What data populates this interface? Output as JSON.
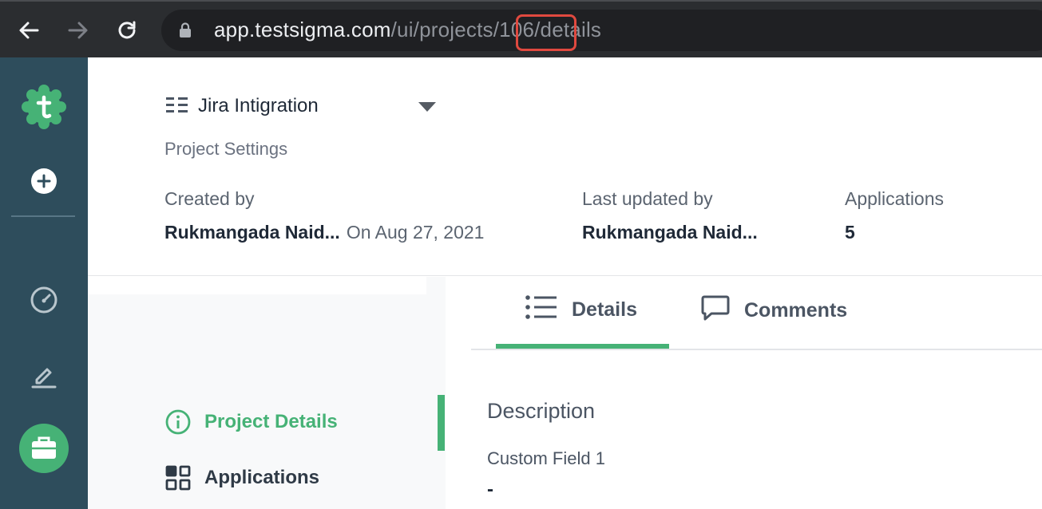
{
  "browser": {
    "url_host": "app.testsigma.com",
    "url_path": "/ui/projects/106/details"
  },
  "header": {
    "project_name": "Jira Intigration",
    "project_subtitle": "Project Settings",
    "created_by_label": "Created by",
    "created_by_value": "Rukmangada Naid...",
    "created_on": "On Aug 27, 2021",
    "last_updated_label": "Last updated by",
    "last_updated_value": "Rukmangada Naid...",
    "applications_label": "Applications",
    "applications_value": "5"
  },
  "left_nav": {
    "items": [
      {
        "label": "Project Details",
        "active": true
      },
      {
        "label": "Applications",
        "active": false
      }
    ]
  },
  "tabs": [
    {
      "label": "Details",
      "active": true
    },
    {
      "label": "Comments",
      "active": false
    }
  ],
  "details": {
    "description_label": "Description",
    "custom_field_label": "Custom Field 1",
    "custom_field_value": "-"
  },
  "colors": {
    "accent": "#46b276",
    "sidebar": "#2e4d5c",
    "url_highlight": "#e0493f"
  }
}
